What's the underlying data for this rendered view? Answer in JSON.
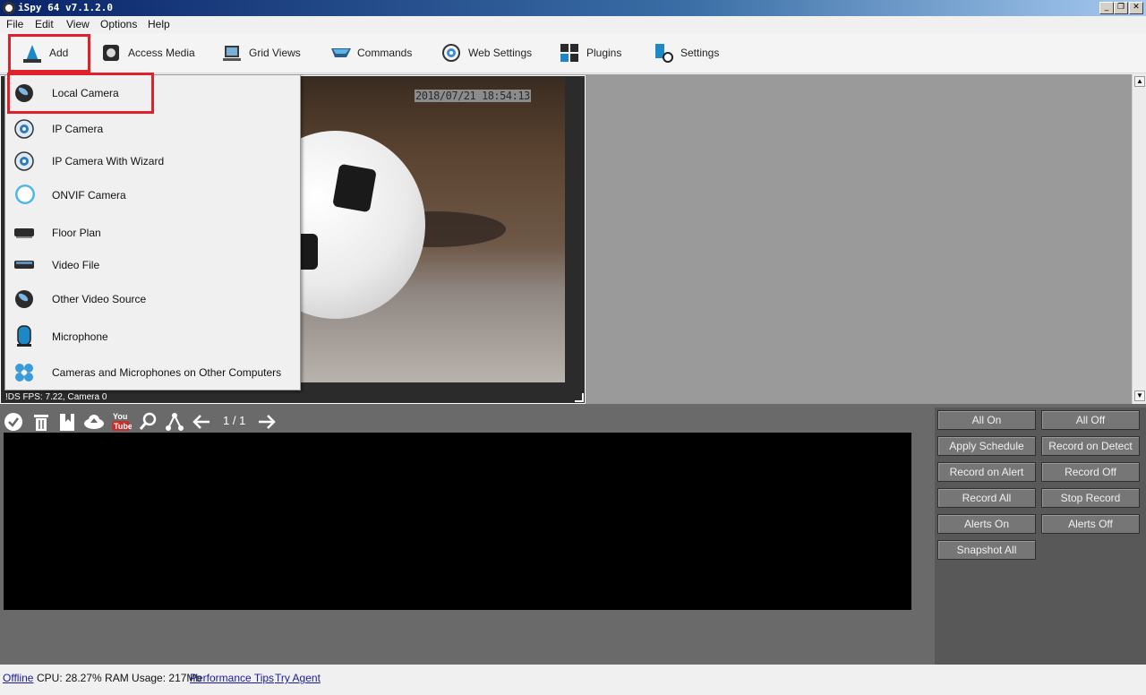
{
  "window": {
    "title": "iSpy 64 v7.1.2.0",
    "controls": [
      "_",
      "❐",
      "✕"
    ]
  },
  "menu": [
    "File",
    "Edit",
    "View",
    "Options",
    "Help"
  ],
  "toolbar": [
    {
      "label": "Add",
      "icon": "add-camera-icon"
    },
    {
      "label": "Access Media",
      "icon": "media-icon"
    },
    {
      "label": "Grid Views",
      "icon": "grid-views-icon"
    },
    {
      "label": "Commands",
      "icon": "commands-icon"
    },
    {
      "label": "Web Settings",
      "icon": "web-settings-icon"
    },
    {
      "label": "Plugins",
      "icon": "plugins-icon"
    },
    {
      "label": "Settings",
      "icon": "settings-icon"
    }
  ],
  "dropdown": [
    {
      "label": "Local Camera",
      "icon": "local-camera-icon"
    },
    {
      "label": "IP Camera",
      "icon": "ip-camera-icon"
    },
    {
      "label": "IP Camera With Wizard",
      "icon": "ip-camera-wizard-icon"
    },
    {
      "label": "ONVIF Camera",
      "icon": "onvif-camera-icon"
    },
    {
      "label": "Floor Plan",
      "icon": "floor-plan-icon"
    },
    {
      "label": "Video File",
      "icon": "video-file-icon"
    },
    {
      "label": "Other Video Source",
      "icon": "other-video-source-icon"
    },
    {
      "label": "Microphone",
      "icon": "microphone-icon"
    },
    {
      "label": "Cameras and Microphones on Other Computers",
      "icon": "remote-computers-icon"
    }
  ],
  "camera": {
    "timestamp": "2018/07/21 18:54:13",
    "status": "!DS  FPS: 7.22, Camera 0"
  },
  "media_tools": {
    "page": "1 / 1",
    "icons": [
      "check-icon",
      "trash-icon",
      "bookmark-icon",
      "cloud-upload-icon",
      "youtube-icon",
      "search-icon",
      "share-icon",
      "prev-arrow-icon",
      "next-arrow-icon"
    ]
  },
  "right_panel": [
    "All On",
    "All Off",
    "Apply Schedule",
    "Record on Detect",
    "Record on Alert",
    "Record Off",
    "Record All",
    "Stop Record",
    "Alerts On",
    "Alerts Off",
    "Snapshot All"
  ],
  "status": {
    "offline": "Offline",
    "usage": "CPU: 28.27% RAM Usage: 217Mb",
    "performance_tips": "Performance Tips",
    "try_agent": "Try Agent"
  },
  "colors": {
    "highlight": "#e0202a",
    "panel": "#585858",
    "log_background": "#000000"
  }
}
